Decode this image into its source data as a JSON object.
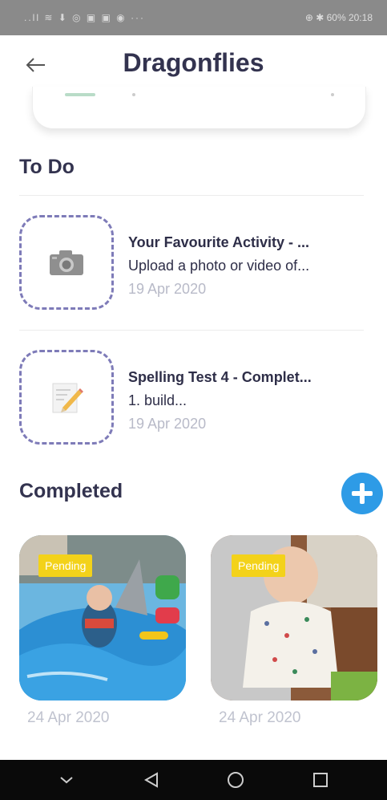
{
  "status_bar": {
    "left_icons": "..ll ≋ ⬇ ◎ ▣ ▣ ◉ ···",
    "right_text": "⊕ ✱ 60% 20:18"
  },
  "header": {
    "title": "Dragonflies"
  },
  "todo": {
    "heading": "To Do",
    "items": [
      {
        "title": "Your Favourite Activity - ...",
        "description": "Upload a photo or video of...",
        "date": "19 Apr 2020",
        "icon": "camera-icon"
      },
      {
        "title": "Spelling Test 4 - Complet...",
        "description": "1. build...",
        "date": "19 Apr 2020",
        "icon": "pencil-paper-icon"
      }
    ]
  },
  "completed": {
    "heading": "Completed",
    "items": [
      {
        "badge": "Pending",
        "date": "24 Apr 2020"
      },
      {
        "badge": "Pending",
        "date": "24 Apr 2020"
      }
    ]
  },
  "colors": {
    "accent_blue": "#2e9be6",
    "dashed_border": "#7e7bb8",
    "badge_yellow": "#f3d21a",
    "title_text": "#33334f"
  }
}
